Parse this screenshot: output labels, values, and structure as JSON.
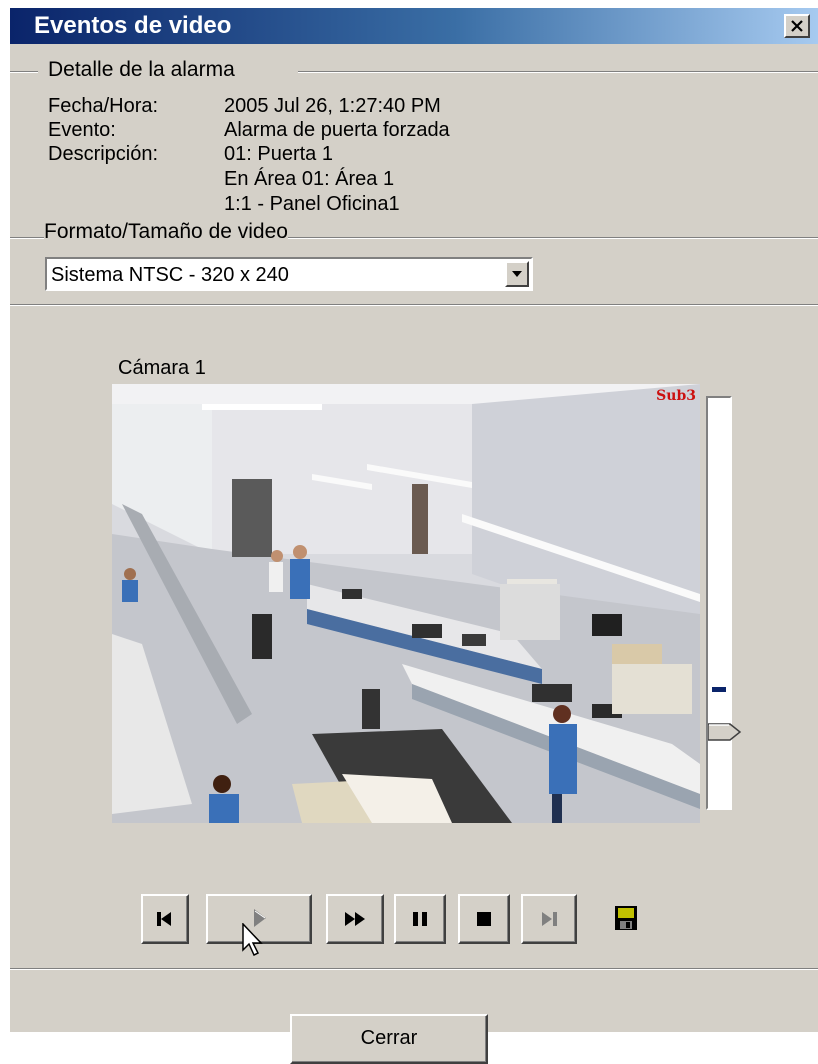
{
  "window": {
    "title": "Eventos de video",
    "close_icon": "close-x-icon"
  },
  "alarm_detail": {
    "group_label": "Detalle de la alarma",
    "fields": [
      {
        "label": "Fecha/Hora:",
        "values": [
          "2005 Jul 26, 1:27:40 PM"
        ]
      },
      {
        "label": "Evento:",
        "values": [
          "Alarma de puerta forzada"
        ]
      },
      {
        "label": "Descripción:",
        "values": [
          "01: Puerta 1",
          "En Área 01: Área 1",
          "1:1 - Panel Oficina1"
        ]
      }
    ]
  },
  "video_format": {
    "group_label": "Formato/Tamaño de video",
    "selected": "Sistema NTSC - 320 x 240"
  },
  "camera": {
    "label": "Cámara 1",
    "osd_text": "Sub3",
    "slider_level": 0.17
  },
  "playback": {
    "buttons": [
      {
        "name": "skip-to-start",
        "icon": "skip-to-start-icon"
      },
      {
        "name": "play",
        "icon": "play-icon",
        "disabled": true
      },
      {
        "name": "fast-forward",
        "icon": "fast-forward-icon"
      },
      {
        "name": "pause",
        "icon": "pause-icon"
      },
      {
        "name": "stop",
        "icon": "stop-icon"
      },
      {
        "name": "skip-to-end",
        "icon": "skip-to-end-icon",
        "disabled": true
      }
    ],
    "save_icon": "floppy-disk-icon"
  },
  "footer": {
    "close_label": "Cerrar"
  },
  "colors": {
    "title_gradient_start": "#0a246a",
    "title_gradient_end": "#a6caf0",
    "dialog_face": "#d4d0c8",
    "osd_red": "#cc1010"
  }
}
